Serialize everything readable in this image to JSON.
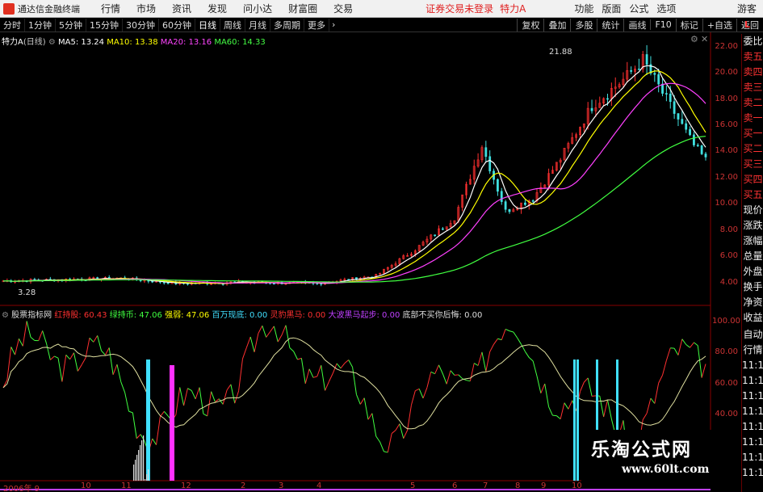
{
  "titlebar": {
    "app_name": "通达信金融终端",
    "menus": [
      "行情",
      "市场",
      "资讯",
      "发现",
      "问小达",
      "财富圈",
      "交易"
    ],
    "alert": "证券交易未登录",
    "stock": "特力A",
    "right_menus": [
      "功能",
      "版面",
      "公式",
      "选项"
    ],
    "guest": "游客"
  },
  "toolbar": {
    "periods": [
      "分时",
      "1分钟",
      "5分钟",
      "15分钟",
      "30分钟",
      "60分钟",
      "日线",
      "周线",
      "月线",
      "多周期",
      "更多"
    ],
    "active_period": "日线",
    "right_buttons": [
      "复权",
      "叠加",
      "多股",
      "统计",
      "画线",
      "F10",
      "标记",
      "+自选",
      "返回"
    ]
  },
  "main_legend": {
    "name": "特力A",
    "period": "(日线)",
    "ma5": "MA5: 13.24",
    "ma10": "MA10: 13.38",
    "ma20": "MA20: 13.16",
    "ma60": "MA60: 14.33",
    "ma5_color": "#ffffff",
    "ma10_color": "#ffff00",
    "ma20_color": "#ff40ff",
    "ma60_color": "#40ff40"
  },
  "sub_legend": {
    "name": "股票指标网",
    "items": [
      {
        "text": "红持股: 60.43",
        "color": "#ff3030"
      },
      {
        "text": "绿持币: 47.06",
        "color": "#40ff40"
      },
      {
        "text": "强弱: 47.06",
        "color": "#ffff00"
      },
      {
        "text": "百万现底: 0.00",
        "color": "#40e0ff"
      },
      {
        "text": "灵豹黑马: 0.00",
        "color": "#ff3030"
      },
      {
        "text": "大波黑马起步: 0.00",
        "color": "#c040ff"
      },
      {
        "text": "底部不买你后悔: 0.00",
        "color": "#dddddd"
      }
    ]
  },
  "price_axis": [
    "22.00",
    "20.00",
    "18.00",
    "16.00",
    "14.00",
    "12.00",
    "10.00",
    "8.00",
    "6.00",
    "4.00"
  ],
  "indicator_axis": [
    "100.00",
    "80.00",
    "60.00",
    "40.00"
  ],
  "annotations": {
    "high": "21.88",
    "low": "3.28"
  },
  "x_axis": [
    "2006年 9",
    "10",
    "11",
    "12",
    "2",
    "3",
    "4",
    "5",
    "6",
    "7",
    "8",
    "9",
    "10"
  ],
  "sidebar": {
    "quote_items": [
      "委比",
      "卖五",
      "卖四",
      "卖三",
      "卖二",
      "卖一",
      "买一",
      "买二",
      "买三",
      "买四",
      "买五",
      "现价",
      "涨跌",
      "涨幅",
      "总量",
      "外盘",
      "换手",
      "净资",
      "收益"
    ],
    "quote_red": [
      "卖五",
      "卖四",
      "卖三",
      "卖二",
      "卖一",
      "买一",
      "买二",
      "买三",
      "买四",
      "买五"
    ],
    "bottom_items": [
      "自动",
      "行情",
      "11:1",
      "11:1",
      "11:1",
      "11:1",
      "11:1",
      "11:1",
      "11:1",
      "11:1"
    ],
    "corner": "L"
  },
  "watermark": {
    "cn": "乐淘公式网",
    "url": "www.60lt.com"
  }
}
